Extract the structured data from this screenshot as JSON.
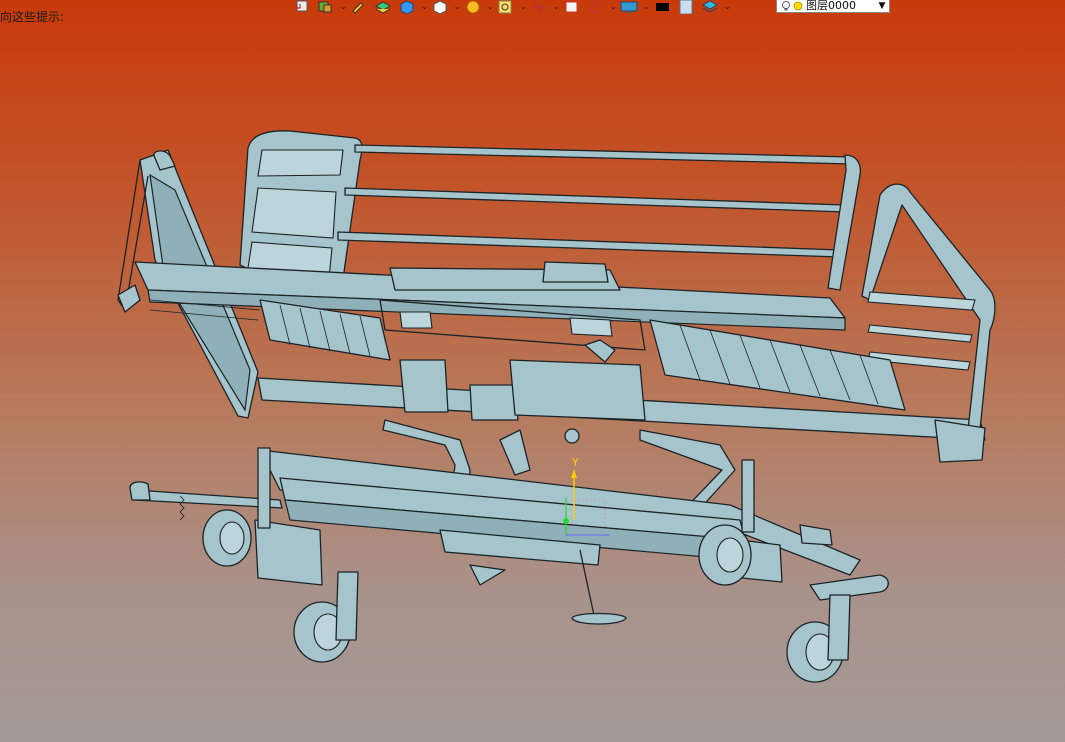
{
  "hint_text": "向这些提示:",
  "toolbar": {
    "icons": [
      "select-icon",
      "layer-edit-icon",
      "pencil-icon",
      "layer-stack-icon",
      "cube-icon",
      "white-cube-icon",
      "render-icon",
      "zoom-icon",
      "transform-icon",
      "rect-icon",
      "frame-icon",
      "monitor-icon",
      "color-black-icon",
      "page-icon",
      "layers-icon"
    ]
  },
  "layer_select": {
    "value": "图层0000"
  },
  "colors": {
    "bg_top": "#c93a0a",
    "bg_bottom": "#a29a97",
    "model_fill": "#a6c4cc",
    "model_edge": "#1b2326"
  },
  "axis": {
    "y_label": "Y"
  }
}
